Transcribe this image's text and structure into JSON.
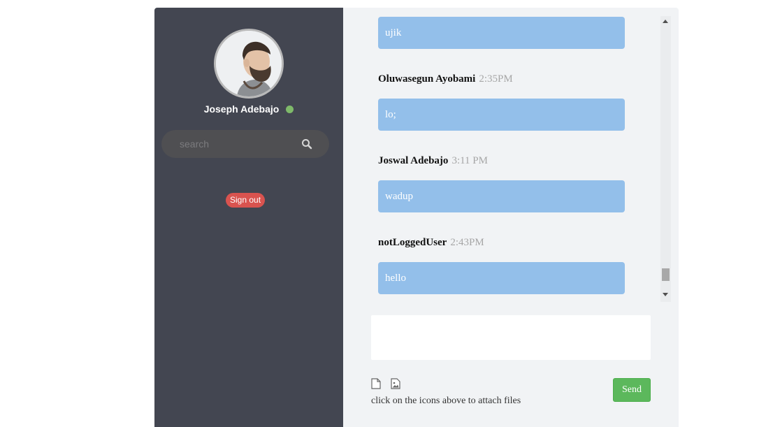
{
  "sidebar": {
    "user_name": "Joseph Adebajo",
    "status_color": "#7fba6a",
    "search": {
      "placeholder": "search",
      "icon": "search-icon"
    },
    "sign_out_label": "Sign out"
  },
  "chat": {
    "messages": [
      {
        "sender": "",
        "time": "",
        "text": "ujik"
      },
      {
        "sender": "Oluwasegun Ayobami",
        "time": "2:35PM",
        "text": "lo;"
      },
      {
        "sender": "Joswal Adebajo",
        "time": "3:11 PM",
        "text": "wadup"
      },
      {
        "sender": "notLoggedUser",
        "time": "2:43PM",
        "text": "hello"
      }
    ],
    "bubble_color": "#93bfea"
  },
  "composer": {
    "value": "",
    "attach_file_icon": "file-icon",
    "attach_image_icon": "image-icon",
    "hint": "click on the icons above to attach files",
    "send_label": "Send",
    "send_color": "#5cb85c"
  },
  "colors": {
    "sidebar_bg": "#434651",
    "main_bg": "#f1f3f5",
    "sign_out": "#d9534f"
  }
}
